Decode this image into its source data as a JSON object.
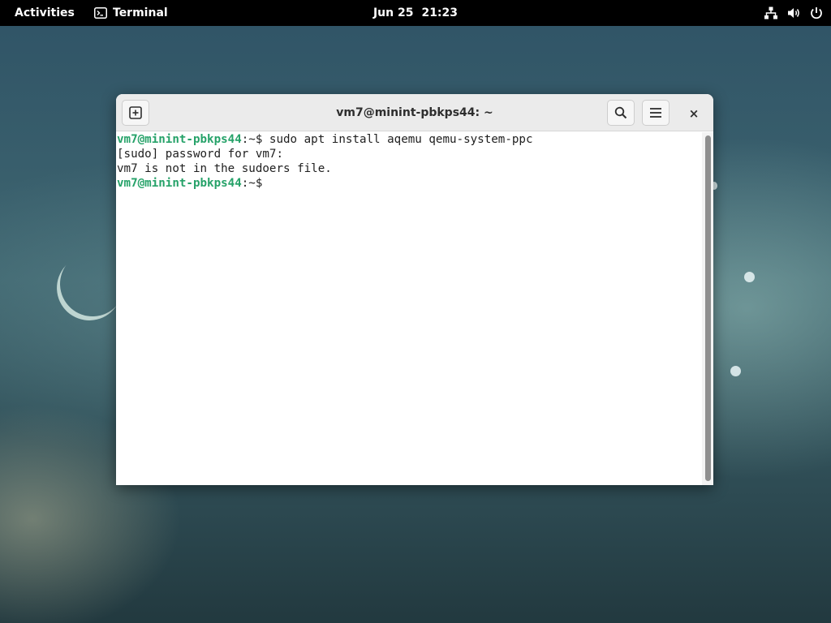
{
  "topbar": {
    "activities_label": "Activities",
    "app_name": "Terminal",
    "date": "Jun 25",
    "time": "21:23",
    "status_icons": [
      "network-icon",
      "volume-icon",
      "power-icon"
    ]
  },
  "window": {
    "title": "vm7@minint-pbkps44: ~",
    "buttons": [
      "new-tab-icon",
      "search-icon",
      "hamburger-menu-icon",
      "close-icon"
    ],
    "close_glyph": "×"
  },
  "terminal": {
    "lines": [
      {
        "type": "prompt",
        "user_host": "vm7@minint-pbkps44",
        "path_symbol": ":~$",
        "command": " sudo apt install aqemu qemu-system-ppc"
      },
      {
        "type": "output",
        "text": "[sudo] password for vm7:"
      },
      {
        "type": "output",
        "text": "vm7 is not in the sudoers file."
      },
      {
        "type": "prompt",
        "user_host": "vm7@minint-pbkps44",
        "path_symbol": ":~$",
        "command": ""
      }
    ]
  },
  "colors": {
    "topbar_bg": "#000000",
    "prompt_green": "#26a269",
    "headerbar_bg": "#ebebeb",
    "terminal_bg": "#ffffff"
  }
}
